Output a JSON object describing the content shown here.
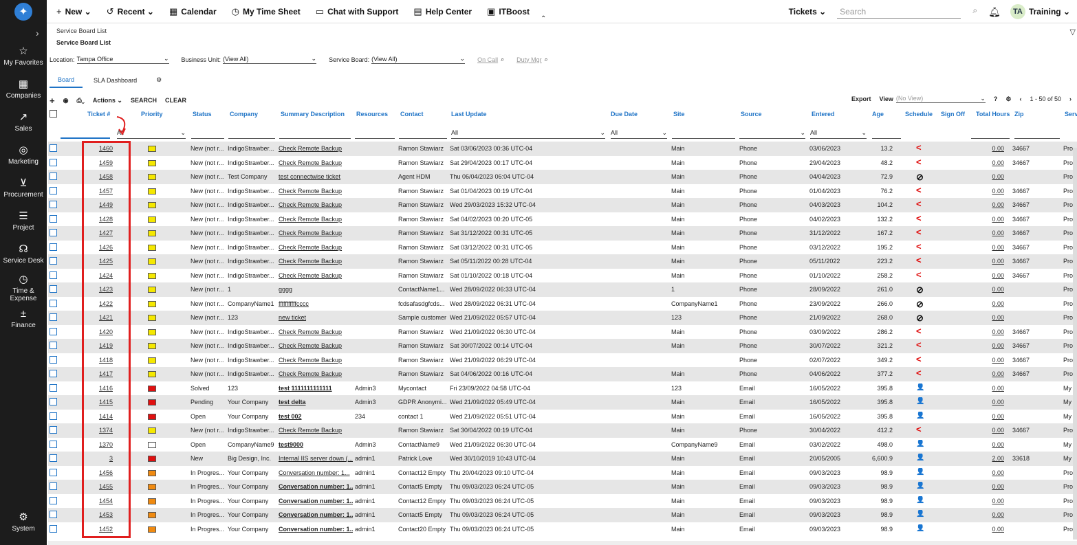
{
  "sidebar": {
    "items": [
      {
        "label": "My Favorites",
        "icon": "star-icon",
        "glyph": "☆"
      },
      {
        "label": "Companies",
        "icon": "building-icon",
        "glyph": "▦"
      },
      {
        "label": "Sales",
        "icon": "chart-icon",
        "glyph": "↗"
      },
      {
        "label": "Marketing",
        "icon": "target-icon",
        "glyph": "◎"
      },
      {
        "label": "Procurement",
        "icon": "cart-icon",
        "glyph": "⊻"
      },
      {
        "label": "Project",
        "icon": "project-icon",
        "glyph": "☰"
      },
      {
        "label": "Service Desk",
        "icon": "headset-icon",
        "glyph": "☊"
      },
      {
        "label": "Time & Expense",
        "icon": "clock-icon",
        "glyph": "◷"
      },
      {
        "label": "Finance",
        "icon": "finance-icon",
        "glyph": "±"
      },
      {
        "label": "System",
        "icon": "gear-icon",
        "glyph": "⚙"
      }
    ]
  },
  "topbar": {
    "new": "New",
    "recent": "Recent",
    "calendar": "Calendar",
    "timesheet": "My Time Sheet",
    "chat": "Chat with Support",
    "help": "Help Center",
    "itboost": "ITBoost",
    "tickets": "Tickets",
    "search_placeholder": "Search",
    "avatar": "TA",
    "user": "Training"
  },
  "breadcrumb": {
    "parent": "Service Board List",
    "current": "Service Board List"
  },
  "filters": {
    "location_label": "Location:",
    "location": "Tampa Office",
    "bu_label": "Business Unit:",
    "bu": "(View All)",
    "board_label": "Service Board:",
    "board": "(View All)",
    "oncall": "On Call",
    "dutymgr": "Duty Mgr"
  },
  "tabs": {
    "board": "Board",
    "sla": "SLA Dashboard"
  },
  "toolbar": {
    "actions": "Actions",
    "search": "SEARCH",
    "clear": "CLEAR",
    "export": "Export",
    "view": "View",
    "view_value": "(No View)",
    "pager": "1 - 50 of 50"
  },
  "columns": {
    "ticket": "Ticket #",
    "priority": "Priority",
    "status": "Status",
    "company": "Company",
    "summary": "Summary Description",
    "resources": "Resources",
    "contact": "Contact",
    "last_update": "Last Update",
    "due": "Due Date",
    "site": "Site",
    "source": "Source",
    "entered": "Entered",
    "age": "Age",
    "schedule": "Schedule",
    "signoff": "Sign Off",
    "hours": "Total Hours",
    "zip": "Zip",
    "serv": "Serv"
  },
  "filter_values": {
    "priority": "All",
    "last_update": "All",
    "due": "All",
    "entered": "All"
  },
  "colors": {
    "yellow": "#f5e800",
    "red": "#e01010",
    "orange": "#f08a10",
    "white": "#ffffff"
  },
  "rows": [
    {
      "t": "1460",
      "p": "yellow",
      "s": "New (not r...",
      "c": "IndigoStrawber...",
      "d": "Check Remote Backup",
      "r": "",
      "ct": "Ramon Stawiarz",
      "u": "Sat 03/06/2023 00:36 UTC-04",
      "si": "Main",
      "so": "Phone",
      "e": "03/06/2023",
      "a": "13.2",
      "sc": "<",
      "h": "0.00",
      "z": "34667",
      "sv": "Pro"
    },
    {
      "t": "1459",
      "p": "yellow",
      "s": "New (not r...",
      "c": "IndigoStrawber...",
      "d": "Check Remote Backup",
      "r": "",
      "ct": "Ramon Stawiarz",
      "u": "Sat 29/04/2023 00:17 UTC-04",
      "si": "Main",
      "so": "Phone",
      "e": "29/04/2023",
      "a": "48.2",
      "sc": "<",
      "h": "0.00",
      "z": "34667",
      "sv": "Pro"
    },
    {
      "t": "1458",
      "p": "yellow",
      "s": "New (not r...",
      "c": "Test Company",
      "d": "test connectwise ticket",
      "r": "",
      "ct": "Agent HDM",
      "u": "Thu 06/04/2023 06:04 UTC-04",
      "si": "Main",
      "so": "Phone",
      "e": "04/04/2023",
      "a": "72.9",
      "sc": "⊘",
      "h": "0.00",
      "z": "",
      "sv": "Pro"
    },
    {
      "t": "1457",
      "p": "yellow",
      "s": "New (not r...",
      "c": "IndigoStrawber...",
      "d": "Check Remote Backup",
      "r": "",
      "ct": "Ramon Stawiarz",
      "u": "Sat 01/04/2023 00:19 UTC-04",
      "si": "Main",
      "so": "Phone",
      "e": "01/04/2023",
      "a": "76.2",
      "sc": "<",
      "h": "0.00",
      "z": "34667",
      "sv": "Pro"
    },
    {
      "t": "1449",
      "p": "yellow",
      "s": "New (not r...",
      "c": "IndigoStrawber...",
      "d": "Check Remote Backup",
      "r": "",
      "ct": "Ramon Stawiarz",
      "u": "Wed 29/03/2023 15:32 UTC-04",
      "si": "Main",
      "so": "Phone",
      "e": "04/03/2023",
      "a": "104.2",
      "sc": "<",
      "h": "0.00",
      "z": "34667",
      "sv": "Pro"
    },
    {
      "t": "1428",
      "p": "yellow",
      "s": "New (not r...",
      "c": "IndigoStrawber...",
      "d": "Check Remote Backup",
      "r": "",
      "ct": "Ramon Stawiarz",
      "u": "Sat 04/02/2023 00:20 UTC-05",
      "si": "Main",
      "so": "Phone",
      "e": "04/02/2023",
      "a": "132.2",
      "sc": "<",
      "h": "0.00",
      "z": "34667",
      "sv": "Pro"
    },
    {
      "t": "1427",
      "p": "yellow",
      "s": "New (not r...",
      "c": "IndigoStrawber...",
      "d": "Check Remote Backup",
      "r": "",
      "ct": "Ramon Stawiarz",
      "u": "Sat 31/12/2022 00:31 UTC-05",
      "si": "Main",
      "so": "Phone",
      "e": "31/12/2022",
      "a": "167.2",
      "sc": "<",
      "h": "0.00",
      "z": "34667",
      "sv": "Pro"
    },
    {
      "t": "1426",
      "p": "yellow",
      "s": "New (not r...",
      "c": "IndigoStrawber...",
      "d": "Check Remote Backup",
      "r": "",
      "ct": "Ramon Stawiarz",
      "u": "Sat 03/12/2022 00:31 UTC-05",
      "si": "Main",
      "so": "Phone",
      "e": "03/12/2022",
      "a": "195.2",
      "sc": "<",
      "h": "0.00",
      "z": "34667",
      "sv": "Pro"
    },
    {
      "t": "1425",
      "p": "yellow",
      "s": "New (not r...",
      "c": "IndigoStrawber...",
      "d": "Check Remote Backup",
      "r": "",
      "ct": "Ramon Stawiarz",
      "u": "Sat 05/11/2022 00:28 UTC-04",
      "si": "Main",
      "so": "Phone",
      "e": "05/11/2022",
      "a": "223.2",
      "sc": "<",
      "h": "0.00",
      "z": "34667",
      "sv": "Pro"
    },
    {
      "t": "1424",
      "p": "yellow",
      "s": "New (not r...",
      "c": "IndigoStrawber...",
      "d": "Check Remote Backup",
      "r": "",
      "ct": "Ramon Stawiarz",
      "u": "Sat 01/10/2022 00:18 UTC-04",
      "si": "Main",
      "so": "Phone",
      "e": "01/10/2022",
      "a": "258.2",
      "sc": "<",
      "h": "0.00",
      "z": "34667",
      "sv": "Pro"
    },
    {
      "t": "1423",
      "p": "yellow",
      "s": "New (not r...",
      "c": "1",
      "d": "gggg",
      "r": "",
      "ct": "ContactName1...",
      "u": "Wed 28/09/2022 06:33 UTC-04",
      "si": "1",
      "so": "Phone",
      "e": "28/09/2022",
      "a": "261.0",
      "sc": "⊘",
      "h": "0.00",
      "z": "",
      "sv": "Pro"
    },
    {
      "t": "1422",
      "p": "yellow",
      "s": "New (not r...",
      "c": "CompanyName1",
      "d": "fffffffffffcccc",
      "r": "",
      "ct": "fcdsafasdgfcds...",
      "u": "Wed 28/09/2022 06:31 UTC-04",
      "si": "CompanyName1",
      "so": "Phone",
      "e": "23/09/2022",
      "a": "266.0",
      "sc": "⊘",
      "h": "0.00",
      "z": "",
      "sv": "Pro"
    },
    {
      "t": "1421",
      "p": "yellow",
      "s": "New (not r...",
      "c": "123",
      "d": "new ticket",
      "r": "",
      "ct": "Sample customer",
      "u": "Wed 21/09/2022 05:57 UTC-04",
      "si": "123",
      "so": "Phone",
      "e": "21/09/2022",
      "a": "268.0",
      "sc": "⊘",
      "h": "0.00",
      "z": "",
      "sv": "Pro"
    },
    {
      "t": "1420",
      "p": "yellow",
      "s": "New (not r...",
      "c": "IndigoStrawber...",
      "d": "Check Remote Backup",
      "r": "",
      "ct": "Ramon Stawiarz",
      "u": "Wed 21/09/2022 06:30 UTC-04",
      "si": "Main",
      "so": "Phone",
      "e": "03/09/2022",
      "a": "286.2",
      "sc": "<",
      "h": "0.00",
      "z": "34667",
      "sv": "Pro"
    },
    {
      "t": "1419",
      "p": "yellow",
      "s": "New (not r...",
      "c": "IndigoStrawber...",
      "d": "Check Remote Backup",
      "r": "",
      "ct": "Ramon Stawiarz",
      "u": "Sat 30/07/2022 00:14 UTC-04",
      "si": "Main",
      "so": "Phone",
      "e": "30/07/2022",
      "a": "321.2",
      "sc": "<",
      "h": "0.00",
      "z": "34667",
      "sv": "Pro"
    },
    {
      "t": "1418",
      "p": "yellow",
      "s": "New (not r...",
      "c": "IndigoStrawber...",
      "d": "Check Remote Backup",
      "r": "",
      "ct": "Ramon Stawiarz",
      "u": "Wed 21/09/2022 06:29 UTC-04",
      "si": "",
      "so": "Phone",
      "e": "02/07/2022",
      "a": "349.2",
      "sc": "<",
      "h": "0.00",
      "z": "34667",
      "sv": "Pro"
    },
    {
      "t": "1417",
      "p": "yellow",
      "s": "New (not r...",
      "c": "IndigoStrawber...",
      "d": "Check Remote Backup",
      "r": "",
      "ct": "Ramon Stawiarz",
      "u": "Sat 04/06/2022 00:16 UTC-04",
      "si": "Main",
      "so": "Phone",
      "e": "04/06/2022",
      "a": "377.2",
      "sc": "<",
      "h": "0.00",
      "z": "34667",
      "sv": "Pro"
    },
    {
      "t": "1416",
      "p": "red",
      "s": "Solved",
      "c": "123",
      "d": "test 1111111111111",
      "b": true,
      "r": "Admin3",
      "ct": "Mycontact",
      "u": "Fri 23/09/2022 04:58 UTC-04",
      "si": "123",
      "so": "Email",
      "e": "16/05/2022",
      "a": "395.8",
      "sc": "👤",
      "h": "0.00",
      "z": "",
      "sv": "My"
    },
    {
      "t": "1415",
      "p": "red",
      "s": "Pending",
      "c": "Your Company",
      "d": "test delta",
      "b": true,
      "r": "Admin3",
      "ct": "GDPR Anonymi...",
      "u": "Wed 21/09/2022 05:49 UTC-04",
      "si": "Main",
      "so": "Email",
      "e": "16/05/2022",
      "a": "395.8",
      "sc": "👤",
      "h": "0.00",
      "z": "",
      "sv": "My"
    },
    {
      "t": "1414",
      "p": "red",
      "s": "Open",
      "c": "Your Company",
      "d": "test 002",
      "b": true,
      "r": "234",
      "ct": "contact 1",
      "u": "Wed 21/09/2022 05:51 UTC-04",
      "si": "Main",
      "so": "Email",
      "e": "16/05/2022",
      "a": "395.8",
      "sc": "👤",
      "h": "0.00",
      "z": "",
      "sv": "My"
    },
    {
      "t": "1374",
      "p": "yellow",
      "s": "New (not r...",
      "c": "IndigoStrawber...",
      "d": "Check Remote Backup",
      "r": "",
      "ct": "Ramon Stawiarz",
      "u": "Sat 30/04/2022 00:19 UTC-04",
      "si": "Main",
      "so": "Phone",
      "e": "30/04/2022",
      "a": "412.2",
      "sc": "<",
      "h": "0.00",
      "z": "34667",
      "sv": "Pro"
    },
    {
      "t": "1370",
      "p": "white",
      "s": "Open",
      "c": "CompanyName9",
      "d": "test9000",
      "b": true,
      "r": "Admin3",
      "ct": "ContactName9",
      "u": "Wed 21/09/2022 06:30 UTC-04",
      "si": "CompanyName9",
      "so": "Email",
      "e": "03/02/2022",
      "a": "498.0",
      "sc": "👤",
      "h": "0.00",
      "z": "",
      "sv": "My"
    },
    {
      "t": "3",
      "p": "red",
      "s": "New",
      "c": "Big Design, Inc.",
      "d": "Internal IIS server down (...",
      "r": "admin1",
      "ct": "Patrick Love",
      "u": "Wed 30/10/2019 10:43 UTC-04",
      "si": "Main",
      "so": "Email",
      "e": "20/05/2005",
      "a": "6,600.9",
      "sc": "👤",
      "h": "2.00",
      "z": "33618",
      "sv": "My"
    },
    {
      "t": "1456",
      "p": "orange",
      "s": "In Progres...",
      "c": "Your Company",
      "d": "Conversation number: 1...",
      "r": "admin1",
      "ct": "Contact12 Empty",
      "u": "Thu 20/04/2023 09:10 UTC-04",
      "si": "Main",
      "so": "Email",
      "e": "09/03/2023",
      "a": "98.9",
      "sc": "👤",
      "h": "0.00",
      "z": "",
      "sv": "Pro"
    },
    {
      "t": "1455",
      "p": "orange",
      "s": "In Progres...",
      "c": "Your Company",
      "d": "Conversation number: 1...",
      "b": true,
      "r": "admin1",
      "ct": "Contact5 Empty",
      "u": "Thu 09/03/2023 06:24 UTC-05",
      "si": "Main",
      "so": "Email",
      "e": "09/03/2023",
      "a": "98.9",
      "sc": "👤",
      "h": "0.00",
      "z": "",
      "sv": "Pro"
    },
    {
      "t": "1454",
      "p": "orange",
      "s": "In Progres...",
      "c": "Your Company",
      "d": "Conversation number: 1...",
      "b": true,
      "r": "admin1",
      "ct": "Contact12 Empty",
      "u": "Thu 09/03/2023 06:24 UTC-05",
      "si": "Main",
      "so": "Email",
      "e": "09/03/2023",
      "a": "98.9",
      "sc": "👤",
      "h": "0.00",
      "z": "",
      "sv": "Pro"
    },
    {
      "t": "1453",
      "p": "orange",
      "s": "In Progres...",
      "c": "Your Company",
      "d": "Conversation number: 1...",
      "b": true,
      "r": "admin1",
      "ct": "Contact5 Empty",
      "u": "Thu 09/03/2023 06:24 UTC-05",
      "si": "Main",
      "so": "Email",
      "e": "09/03/2023",
      "a": "98.9",
      "sc": "👤",
      "h": "0.00",
      "z": "",
      "sv": "Pro"
    },
    {
      "t": "1452",
      "p": "orange",
      "s": "In Progres...",
      "c": "Your Company",
      "d": "Conversation number: 1...",
      "b": true,
      "r": "admin1",
      "ct": "Contact20 Empty",
      "u": "Thu 09/03/2023 06:24 UTC-05",
      "si": "Main",
      "so": "Email",
      "e": "09/03/2023",
      "a": "98.9",
      "sc": "👤",
      "h": "0.00",
      "z": "",
      "sv": "Pro"
    }
  ]
}
